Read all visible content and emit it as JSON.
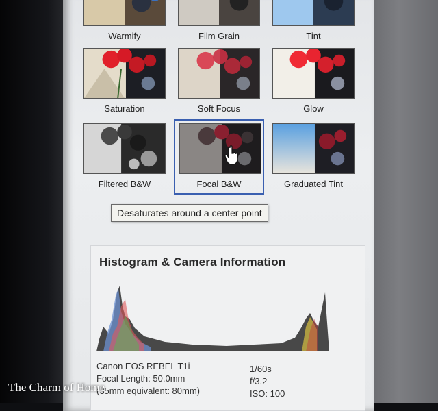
{
  "effects": [
    {
      "label": "Warmify",
      "tone": "warm"
    },
    {
      "label": "Film Grain",
      "tone": "grain"
    },
    {
      "label": "Tint",
      "tone": "tint"
    },
    {
      "label": "Saturation",
      "tone": "sat"
    },
    {
      "label": "Soft Focus",
      "tone": "soft"
    },
    {
      "label": "Glow",
      "tone": "glow"
    },
    {
      "label": "Filtered B&W",
      "tone": "bw"
    },
    {
      "label": "Focal B&W",
      "tone": "focal",
      "selected": true
    },
    {
      "label": "Graduated Tint",
      "tone": "grad"
    }
  ],
  "tooltip": "Desaturates around a center point",
  "histogram": {
    "title": "Histogram & Camera Information",
    "camera": "Canon EOS REBEL T1i",
    "focal_length": "Focal Length: 50.0mm",
    "equivalent": "(35mm equivalent: 80mm)",
    "shutter": "1/60s",
    "aperture": "f/3.2",
    "iso": "ISO: 100"
  },
  "watermark": "The Charm of Home",
  "colors": {
    "accent": "#3a5fb0",
    "red_flower": "#d61f2a"
  }
}
